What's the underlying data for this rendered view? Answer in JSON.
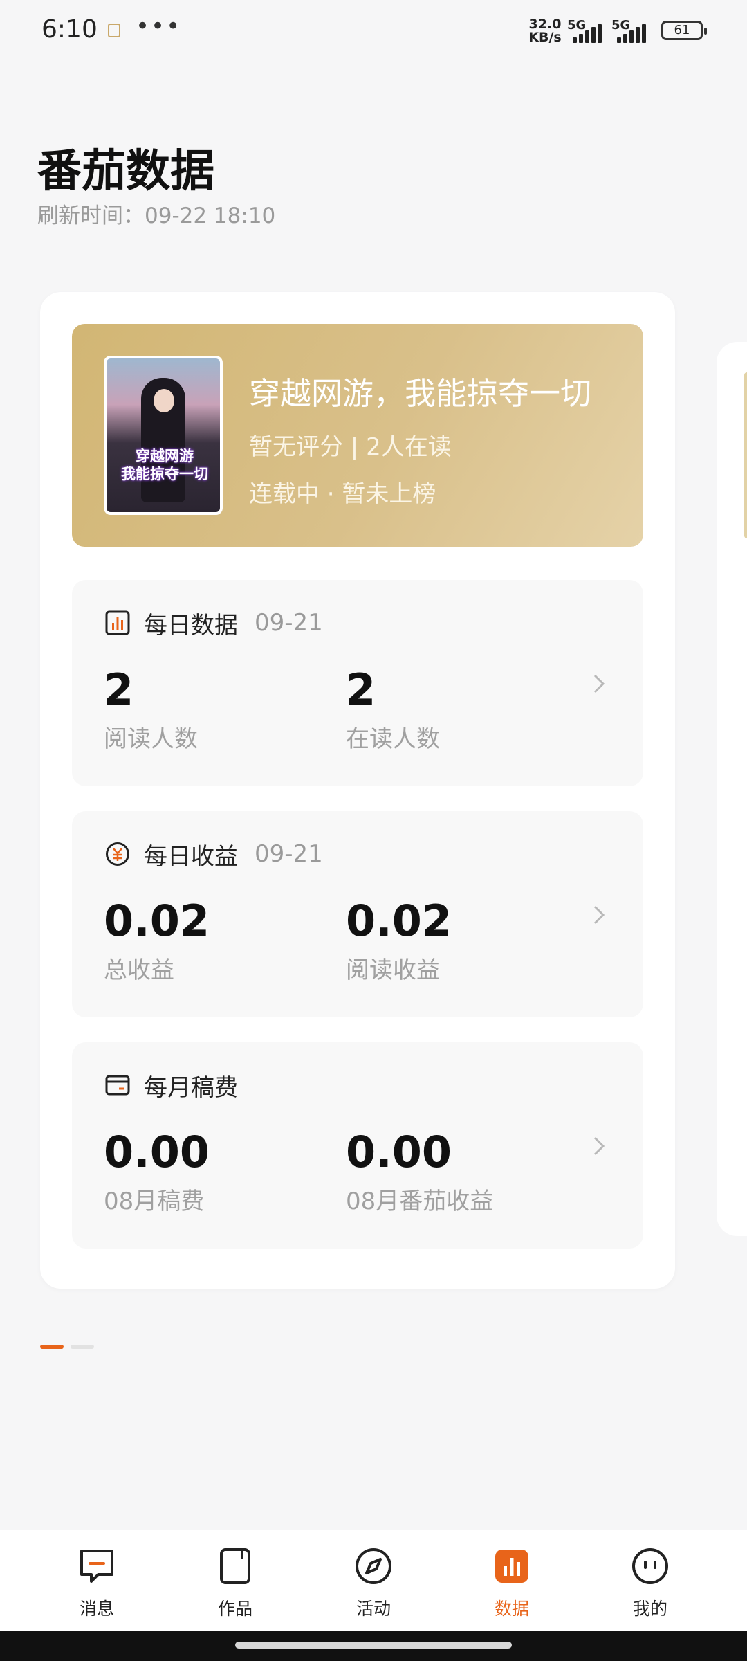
{
  "status_bar": {
    "time": "6:10",
    "more": "•••",
    "net_speed": "32.0\nKB/s",
    "signal1": "5G",
    "signal2": "5G",
    "battery": "61"
  },
  "header": {
    "title": "番茄数据",
    "refresh": "刷新时间：09-22 18:10"
  },
  "book": {
    "title": "穿越网游，我能掠夺一切",
    "meta": "暂无评分 | 2人在读",
    "status": "连载中 · 暂未上榜",
    "cover_text": "穿越网游\n我能掠夺一切"
  },
  "daily_data": {
    "name": "每日数据",
    "date": "09-21",
    "value1": "2",
    "label1": "阅读人数",
    "value2": "2",
    "label2": "在读人数"
  },
  "daily_income": {
    "name": "每日收益",
    "date": "09-21",
    "value1": "0.02",
    "label1": "总收益",
    "value2": "0.02",
    "label2": "阅读收益"
  },
  "monthly_fee": {
    "name": "每月稿费",
    "value1": "0.00",
    "label1": "08月稿费",
    "value2": "0.00",
    "label2": "08月番茄收益"
  },
  "nav": {
    "items": [
      {
        "label": "消息",
        "icon": "message-icon"
      },
      {
        "label": "作品",
        "icon": "works-icon"
      },
      {
        "label": "活动",
        "icon": "compass-icon"
      },
      {
        "label": "数据",
        "icon": "chart-icon",
        "active": true
      },
      {
        "label": "我的",
        "icon": "profile-icon"
      }
    ]
  },
  "colors": {
    "accent": "#e8641a",
    "banner": "#d2b674"
  }
}
